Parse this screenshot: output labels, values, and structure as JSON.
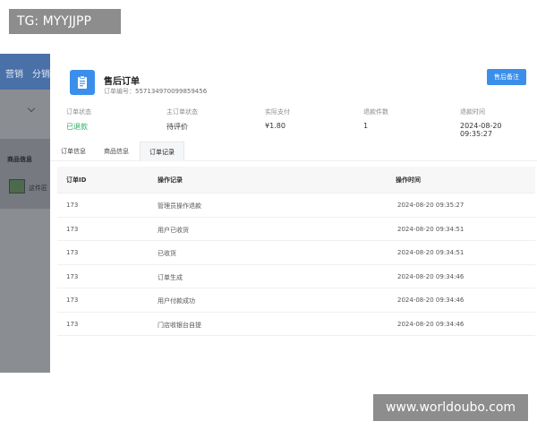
{
  "watermark_top": "TG: MYYJJPP",
  "watermark_bottom": "www.worldoubo.com",
  "background": {
    "nav": [
      "营销",
      "分销"
    ],
    "section_label": "商品信息",
    "item_text": "这件匠"
  },
  "header": {
    "title": "售后订单",
    "order_no_label": "订单编号：",
    "order_no": "557134970099859456",
    "action_button": "售后备注",
    "icon": "document-icon",
    "accent_color": "#3b8fea"
  },
  "summary": [
    {
      "label": "订单状态",
      "value": "已退款",
      "color": "#27ae60"
    },
    {
      "label": "主订单状态",
      "value": "待评价"
    },
    {
      "label": "实际支付",
      "value": "¥1.80"
    },
    {
      "label": "退款件数",
      "value": "1"
    },
    {
      "label": "退款时间",
      "value": "2024-08-20 09:35:27"
    }
  ],
  "tabs": [
    {
      "label": "订单信息",
      "active": false
    },
    {
      "label": "商品信息",
      "active": false
    },
    {
      "label": "订单记录",
      "active": true
    }
  ],
  "table": {
    "columns": [
      "订单ID",
      "操作记录",
      "操作时间"
    ],
    "rows": [
      [
        "173",
        "管理员操作退款",
        "2024-08-20 09:35:27"
      ],
      [
        "173",
        "用户已收货",
        "2024-08-20 09:34:51"
      ],
      [
        "173",
        "已收货",
        "2024-08-20 09:34:51"
      ],
      [
        "173",
        "订单生成",
        "2024-08-20 09:34:46"
      ],
      [
        "173",
        "用户付款成功",
        "2024-08-20 09:34:46"
      ],
      [
        "173",
        "门店收银台自提",
        "2024-08-20 09:34:46"
      ]
    ]
  }
}
